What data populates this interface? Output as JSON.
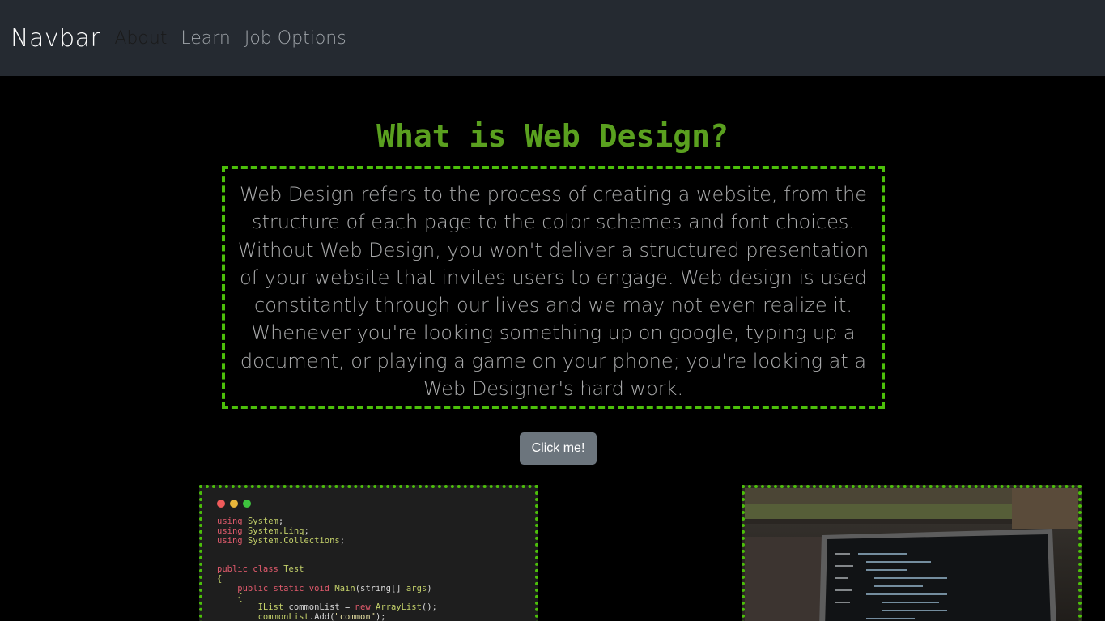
{
  "navbar": {
    "brand": "Navbar",
    "links": [
      {
        "label": "About",
        "active": true
      },
      {
        "label": "Learn",
        "active": false
      },
      {
        "label": "Job Options",
        "active": false
      }
    ]
  },
  "main": {
    "title": "What is Web Design?",
    "description": "Web Design refers to the process of creating a website, from the structure of each page to the color schemes and font choices. Without Web Design, you won't deliver a structured presentation of your website that invites users to engage. Web design is used constitantly through our lives and we may not even realize it. Whenever you're looking something up on google, typing up a document, or playing a game on your phone; you're looking at a Web Designer's hard work.",
    "button_label": "Click me!"
  },
  "images": {
    "left": {
      "code_lines": [
        [
          "using",
          " ",
          "System",
          ";"
        ],
        [
          "using",
          " ",
          "System.Linq",
          ";"
        ],
        [
          "using",
          " ",
          "System.Collections",
          ";"
        ],
        [
          "",
          "",
          "",
          ""
        ],
        [
          "",
          "",
          "",
          ""
        ],
        [
          "public class",
          " ",
          "Test",
          ""
        ],
        [
          "",
          "",
          "{",
          ""
        ],
        [
          "    public static void",
          " ",
          "Main",
          "(string[] args)"
        ],
        [
          "",
          "",
          "    {",
          ""
        ],
        [
          "        ",
          "",
          "IList",
          " commonList = new ArrayList();"
        ],
        [
          "        ",
          "",
          "commonList",
          ".Add(\"common\");"
        ]
      ]
    }
  },
  "colors": {
    "background": "#000000",
    "navbar": "#252a31",
    "accent_green": "#4cbf0a",
    "title_green": "#5aa01f",
    "button": "#6c757d"
  }
}
